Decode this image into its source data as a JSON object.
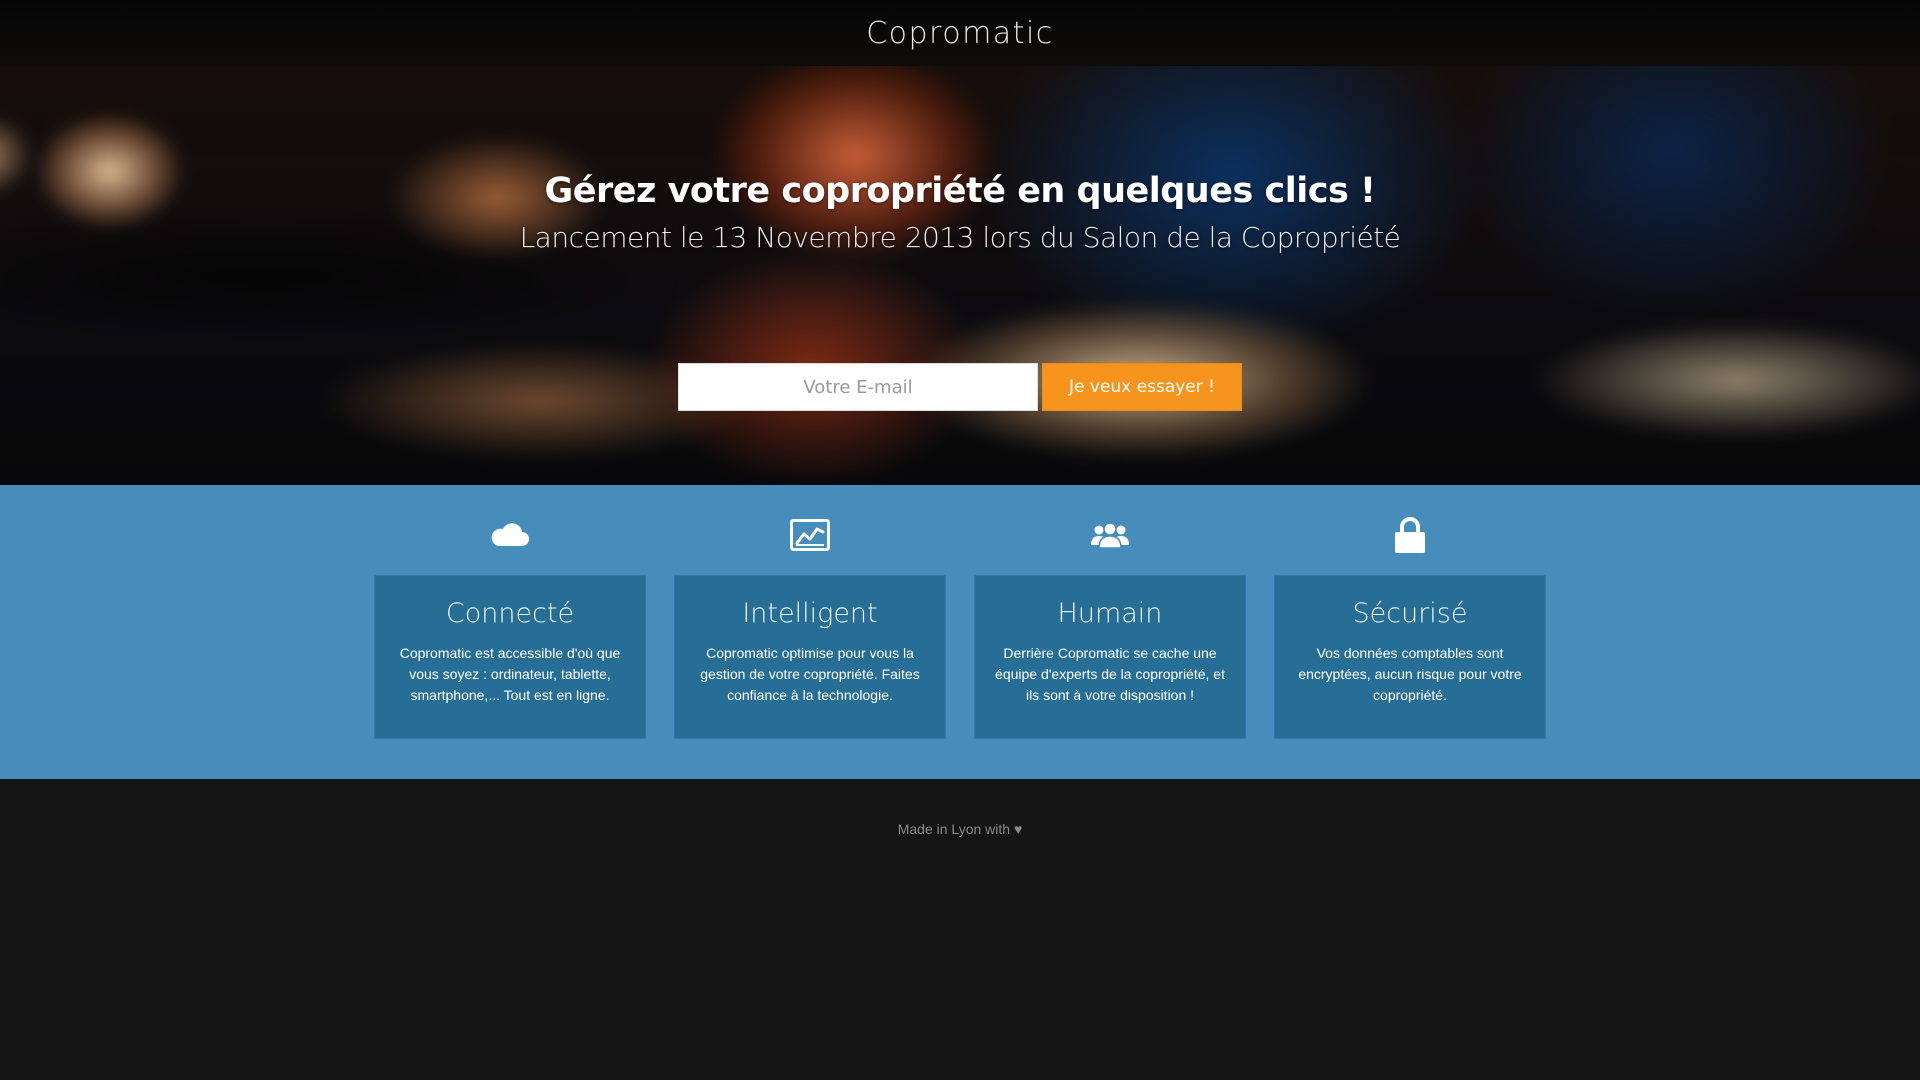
{
  "header": {
    "brand": "Copromatic"
  },
  "hero": {
    "title": "Gérez votre copropriété en quelques clics !",
    "subtitle": "Lancement le 13 Novembre 2013 lors du Salon de la Copropriété",
    "email_placeholder": "Votre E-mail",
    "email_value": "",
    "cta_label": "Je veux essayer !"
  },
  "features": [
    {
      "icon": "cloud-icon",
      "title": "Connecté",
      "text": "Copromatic est accessible d'où que vous soyez : ordinateur, tablette, smartphone,... Tout est en ligne."
    },
    {
      "icon": "chart-icon",
      "title": "Intelligent",
      "text": "Copromatic optimise pour vous la gestion de votre copropriété. Faites confiance à la technologie."
    },
    {
      "icon": "users-icon",
      "title": "Humain",
      "text": "Derrière Copromatic se cache une équipe d'experts de la copropriété, et ils sont à votre disposition !"
    },
    {
      "icon": "lock-icon",
      "title": "Sécurisé",
      "text": "Vos données comptables sont encryptées, aucun risque pour votre copropriété."
    }
  ],
  "footer": {
    "text": "Made in Lyon with ♥"
  },
  "colors": {
    "accent": "#f7941d",
    "features_bg": "#468dbb",
    "card_bg": "#276e97",
    "footer_bg": "#141414"
  }
}
